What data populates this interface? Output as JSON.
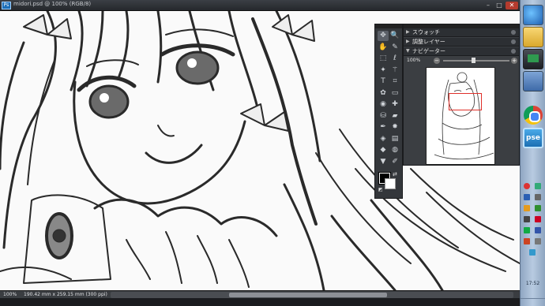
{
  "window": {
    "title": "midori.psd @ 100% (RGB/8)",
    "minimize": "–",
    "maximize": "□",
    "close": "✕",
    "app_icon": "Ps"
  },
  "status": {
    "zoom": "100%",
    "doc_size": "190.42 mm x 259.15 mm (300 ppi)"
  },
  "tools": [
    {
      "name": "move-tool",
      "glyph": "✥"
    },
    {
      "name": "zoom-tool",
      "glyph": "🔍"
    },
    {
      "name": "hand-tool",
      "glyph": "✋"
    },
    {
      "name": "eyedropper-tool",
      "glyph": "✎"
    },
    {
      "name": "marquee-tool",
      "glyph": "⬚"
    },
    {
      "name": "lasso-tool",
      "glyph": "ℓ"
    },
    {
      "name": "quick-select-tool",
      "glyph": "✦"
    },
    {
      "name": "magic-wand-tool",
      "glyph": "⚚"
    },
    {
      "name": "type-tool",
      "glyph": "T"
    },
    {
      "name": "crop-tool",
      "glyph": "⌗"
    },
    {
      "name": "cookie-cutter-tool",
      "glyph": "✿"
    },
    {
      "name": "straighten-tool",
      "glyph": "▭"
    },
    {
      "name": "red-eye-tool",
      "glyph": "◉"
    },
    {
      "name": "healing-brush-tool",
      "glyph": "✚"
    },
    {
      "name": "clone-stamp-tool",
      "glyph": "⛁"
    },
    {
      "name": "eraser-tool",
      "glyph": "▰"
    },
    {
      "name": "brush-tool",
      "glyph": "✒"
    },
    {
      "name": "smart-brush-tool",
      "glyph": "✸"
    },
    {
      "name": "paint-bucket-tool",
      "glyph": "◈"
    },
    {
      "name": "gradient-tool",
      "glyph": "▤"
    },
    {
      "name": "shape-tool",
      "glyph": "◆"
    },
    {
      "name": "sponge-tool",
      "glyph": "◍"
    },
    {
      "name": "blur-tool",
      "glyph": "▼"
    },
    {
      "name": "pencil-tool",
      "glyph": "✐"
    }
  ],
  "colors": {
    "foreground": "#000000",
    "background": "#ffffff",
    "swap": "⇄",
    "default": "◩"
  },
  "palettes": {
    "tabs": [
      {
        "label": "スウォッチ"
      },
      {
        "label": "調整レイヤー"
      },
      {
        "label": "ナビゲーター"
      }
    ],
    "navigator": {
      "zoom": "100%",
      "zoom_out": "−",
      "zoom_in": "+",
      "zoom_fraction": 0.45
    }
  },
  "taskbar": {
    "pse_label": "pse",
    "clock": "17:52"
  },
  "accent": {
    "panel": "#3b3e42",
    "nav_box": "#e0302a",
    "close": "#b53b2e"
  }
}
